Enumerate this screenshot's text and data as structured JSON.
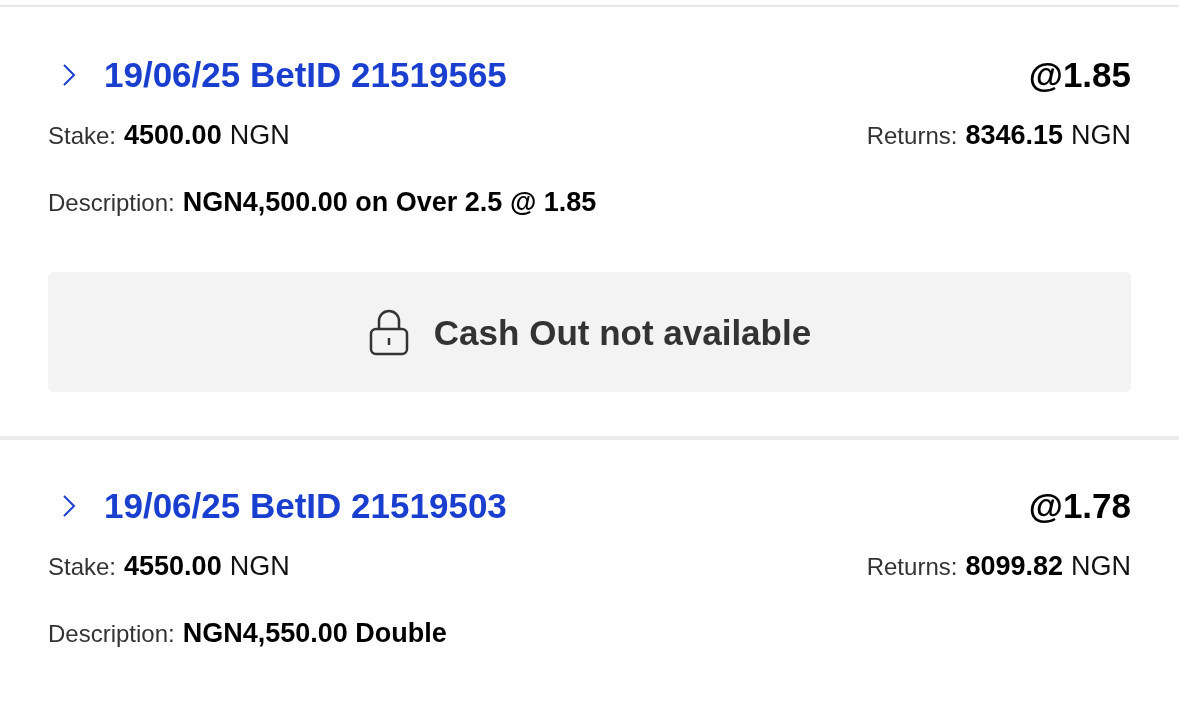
{
  "bets": [
    {
      "title": "19/06/25 BetID 21519565",
      "odds": "@1.85",
      "stake_label": "Stake:",
      "stake_value": "4500.00",
      "stake_currency": "NGN",
      "returns_label": "Returns:",
      "returns_value": "8346.15",
      "returns_currency": "NGN",
      "description_label": "Description:",
      "description": "NGN4,500.00 on Over 2.5 @ 1.85",
      "cash_out": {
        "text": "Cash Out not available"
      }
    },
    {
      "title": "19/06/25 BetID 21519503",
      "odds": "@1.78",
      "stake_label": "Stake:",
      "stake_value": "4550.00",
      "stake_currency": "NGN",
      "returns_label": "Returns:",
      "returns_value": "8099.82",
      "returns_currency": "NGN",
      "description_label": "Description:",
      "description": "NGN4,550.00 Double"
    }
  ]
}
